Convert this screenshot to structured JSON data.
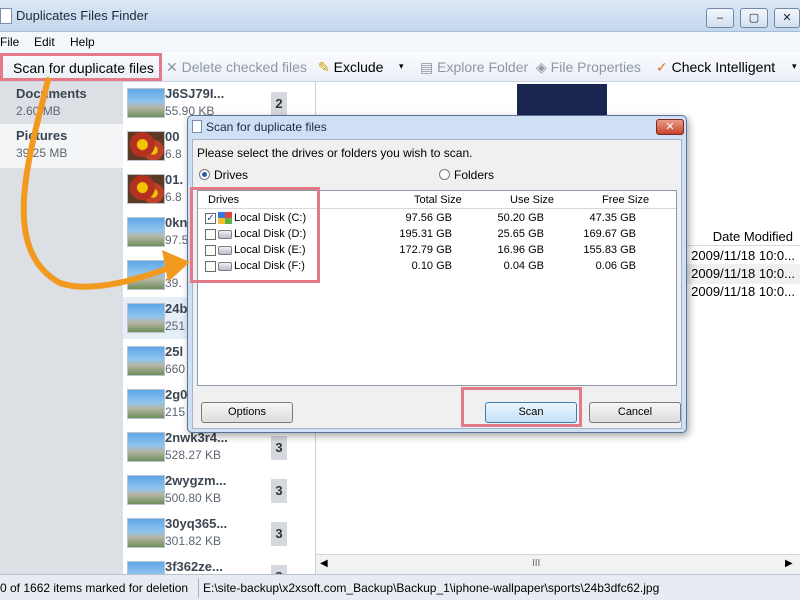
{
  "window": {
    "title": "Duplicates Files Finder",
    "minimize": "–",
    "maximize": "▢",
    "close": "✕"
  },
  "menu": [
    "File",
    "Edit",
    "Help"
  ],
  "toolbar": {
    "scan": "Scan for duplicate files",
    "delete": "Delete checked files",
    "exclude": "Exclude",
    "explore": "Explore Folder",
    "properties": "File Properties",
    "check": "Check Intelligent",
    "dropdown": "▾"
  },
  "categories": [
    {
      "name": "Documents",
      "size": "2.60 MB"
    },
    {
      "name": "Pictures",
      "size": "39.25 MB"
    }
  ],
  "files": [
    {
      "name": "J6SJ79I...",
      "size": "55.90 KB",
      "count": "2",
      "thumb": "landscape"
    },
    {
      "name": "00",
      "size": "6.8",
      "count": "",
      "thumb": "flower"
    },
    {
      "name": "01.",
      "size": "6.8",
      "count": "",
      "thumb": "flower"
    },
    {
      "name": "0kn",
      "size": "97.5",
      "count": "",
      "thumb": "landscape"
    },
    {
      "name": "1",
      "size": "39.",
      "count": "",
      "thumb": "landscape"
    },
    {
      "name": "24b",
      "size": "251",
      "count": "",
      "thumb": "landscape"
    },
    {
      "name": "25l",
      "size": "660",
      "count": "",
      "thumb": "landscape"
    },
    {
      "name": "2g0",
      "size": "215",
      "count": "",
      "thumb": "landscape"
    },
    {
      "name": "2nwk3r4...",
      "size": "528.27 KB",
      "count": "3",
      "thumb": "landscape"
    },
    {
      "name": "2wygzm...",
      "size": "500.80 KB",
      "count": "3",
      "thumb": "landscape"
    },
    {
      "name": "30yq365...",
      "size": "301.82 KB",
      "count": "3",
      "thumb": "landscape"
    },
    {
      "name": "3f362ze...",
      "size": "",
      "count": "3",
      "thumb": "landscape"
    }
  ],
  "details": {
    "column_header": "Date Modified",
    "rows": [
      "2009/11/18 10:0...",
      "2009/11/18 10:0...",
      "2009/11/18 10:0..."
    ],
    "scroll_grip": "III"
  },
  "status": {
    "marked": "0 of 1662 items marked for deletion",
    "path": "E:\\site-backup\\x2xsoft.com_Backup\\Backup_1\\iphone-wallpaper\\sports\\24b3dfc62.jpg"
  },
  "dialog": {
    "title": "Scan for duplicate files",
    "close": "✕",
    "instruction": "Please select the drives or folders you wish to scan.",
    "radio_drives": "Drives",
    "radio_folders": "Folders",
    "columns": [
      "Drives",
      "Total Size",
      "Use Size",
      "Free Size"
    ],
    "drives": [
      {
        "name": "Local Disk (C:)",
        "total": "97.56 GB",
        "used": "50.20 GB",
        "free": "47.35 GB",
        "checked": true,
        "system": true
      },
      {
        "name": "Local Disk (D:)",
        "total": "195.31 GB",
        "used": "25.65 GB",
        "free": "169.67 GB",
        "checked": false,
        "system": false
      },
      {
        "name": "Local Disk (E:)",
        "total": "172.79 GB",
        "used": "16.96 GB",
        "free": "155.83 GB",
        "checked": false,
        "system": false
      },
      {
        "name": "Local Disk (F:)",
        "total": "0.10 GB",
        "used": "0.04 GB",
        "free": "0.06 GB",
        "checked": false,
        "system": false
      }
    ],
    "options": "Options",
    "scan": "Scan",
    "cancel": "Cancel"
  },
  "colors": {
    "highlight_box": "#e47a88",
    "arrow": "#f29a1f"
  }
}
